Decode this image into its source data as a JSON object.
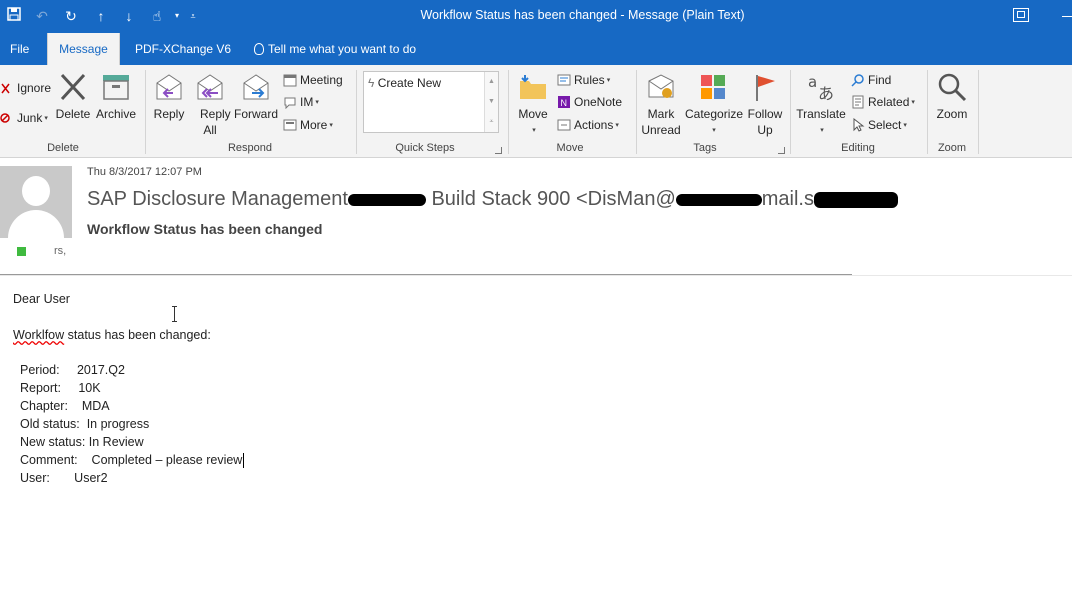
{
  "window": {
    "title": "Workflow Status has been changed  -  Message (Plain Text)"
  },
  "tabs": [
    {
      "label": "File"
    },
    {
      "label": "Message"
    },
    {
      "label": "PDF-XChange V6"
    },
    {
      "label": "Tell me what you want to do"
    }
  ],
  "ribbon": {
    "delete_group": {
      "label": "Delete",
      "ignore": "Ignore",
      "junk": "Junk",
      "delete": "Delete",
      "archive": "Archive"
    },
    "respond_group": {
      "label": "Respond",
      "reply": "Reply",
      "reply_all": "Reply All",
      "forward": "Forward",
      "meeting": "Meeting",
      "im": "IM",
      "more": "More"
    },
    "quick_steps_group": {
      "label": "Quick Steps",
      "create_new": "Create New"
    },
    "move_group": {
      "label": "Move",
      "move": "Move",
      "rules": "Rules",
      "onenote": "OneNote",
      "actions": "Actions"
    },
    "tags_group": {
      "label": "Tags",
      "mark_unread": "Mark Unread",
      "categorize": "Categorize",
      "follow_up": "Follow Up"
    },
    "editing_group": {
      "label": "Editing",
      "translate": "Translate",
      "find": "Find",
      "related": "Related",
      "select": "Select"
    },
    "zoom_group": {
      "label": "Zoom",
      "zoom": "Zoom"
    }
  },
  "message": {
    "date": "Thu 8/3/2017 12:07 PM",
    "from_start": "SAP Disclosure Management",
    "from_mid": "Build Stack 900 <DisMan@",
    "from_end": "mail.s",
    "subject": "Workflow Status has been changed",
    "to_partial": "rs,",
    "body": {
      "greeting": "Dear User",
      "intro_word": "Worklfow",
      "intro_rest": " status has been changed:",
      "period": "Period:     2017.Q2",
      "report": "Report:     10K",
      "chapter": "Chapter:    MDA",
      "old_status": "Old status:  In progress",
      "new_status": "New status: In Review",
      "comment": "Comment:    Completed – please review",
      "user": "User:       User2"
    }
  },
  "colors": {
    "titlebar": "#1769c4",
    "ribbon_bg": "#f3f3f3",
    "presence": "#3fba3f"
  }
}
